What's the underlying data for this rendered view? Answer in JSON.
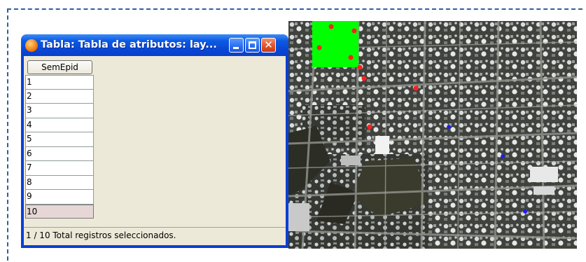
{
  "window": {
    "title": "Tabla: Tabla de atributos: lay...",
    "close_glyph": "✕"
  },
  "table": {
    "column_header": "SemEpid",
    "rows": [
      "1",
      "2",
      "3",
      "4",
      "5",
      "6",
      "7",
      "8",
      "9",
      "10"
    ],
    "selected_row": "10"
  },
  "status": {
    "text": "1 / 10 Total registros seleccionados."
  },
  "map": {
    "highlight_polygon_color": "#00ff00",
    "red_point_color": "#ff2020",
    "blue_point_color": "#1a1aff",
    "red_point_count": 8,
    "blue_point_count": 3
  },
  "colors": {
    "frame_border": "#2f5fa3",
    "titlebar": "#0a3fd6",
    "window_body": "#ece9d8"
  }
}
